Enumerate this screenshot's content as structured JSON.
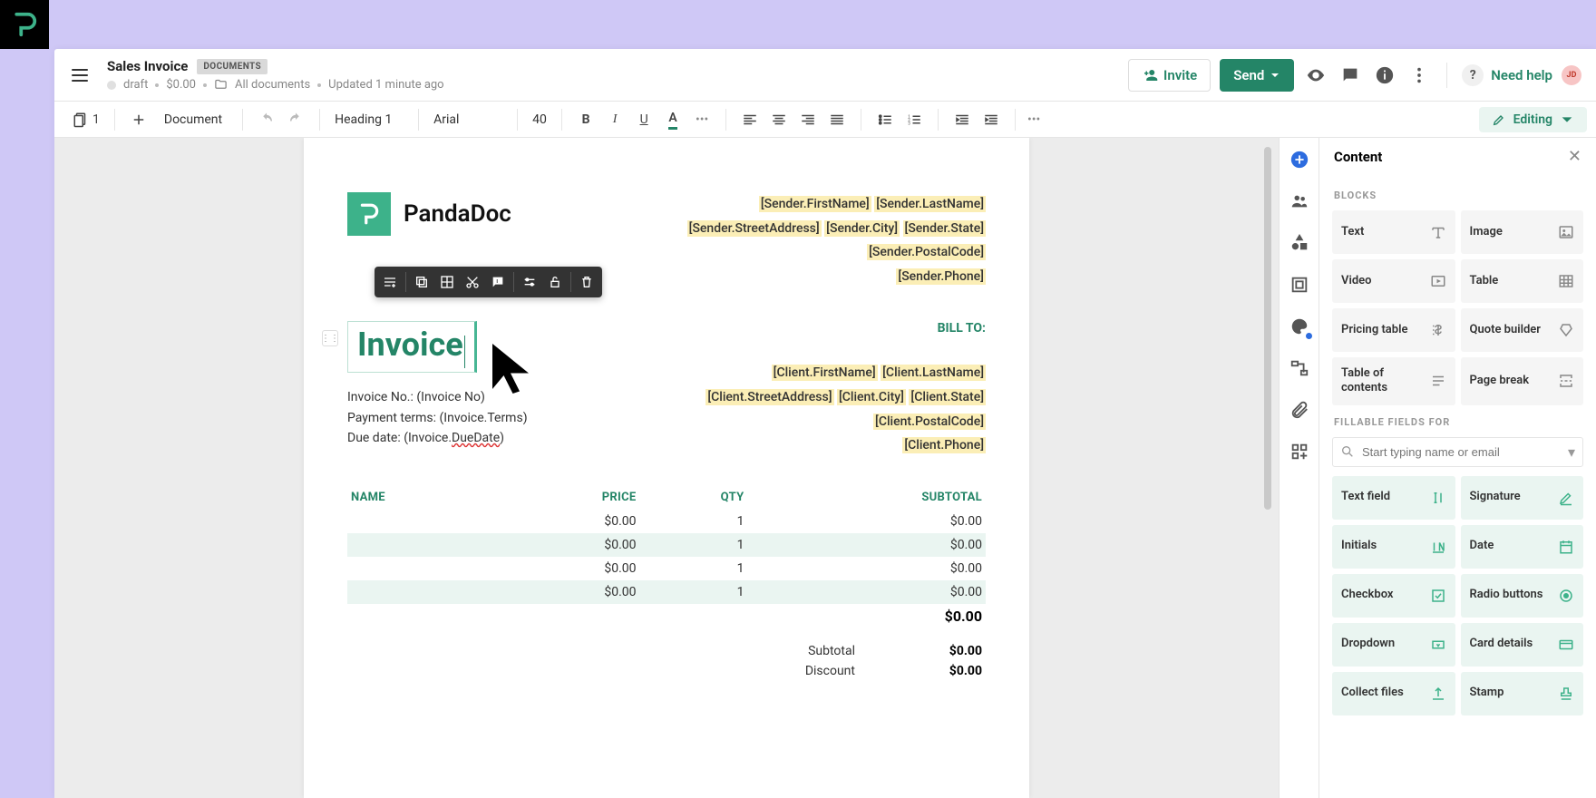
{
  "header": {
    "title": "Sales Invoice",
    "badge": "DOCUMENTS",
    "status": "draft",
    "price": "$0.00",
    "folder": "All documents",
    "updated": "Updated 1 minute ago",
    "invite": "Invite",
    "send": "Send",
    "help": "Need help",
    "avatar": "JD"
  },
  "toolbar": {
    "page_count": "1",
    "document": "Document",
    "heading": "Heading 1",
    "font": "Arial",
    "size": "40",
    "mode": "Editing"
  },
  "doc": {
    "brand": "PandaDoc",
    "sender": {
      "first": "[Sender.FirstName]",
      "last": "[Sender.LastName]",
      "street": "[Sender.StreetAddress]",
      "city": "[Sender.City]",
      "state": "[Sender.State]",
      "postal": "[Sender.PostalCode]",
      "phone": "[Sender.Phone]"
    },
    "invoice_heading": "Invoice",
    "billto_label": "BILL TO:",
    "meta": {
      "no_label": "Invoice No.: ",
      "no_val": "(Invoice No)",
      "terms_label": "Payment terms: ",
      "terms_val": "(Invoice.Terms)",
      "due_label": "Due date: ",
      "due_prefix": "(Invoice.",
      "due_squiggle": "DueDate",
      "due_suffix": ")"
    },
    "client": {
      "first": "[Client.FirstName]",
      "last": "[Client.LastName]",
      "street": "[Client.StreetAddress]",
      "city": "[Client.City]",
      "state": "[Client.State]",
      "postal": "[Client.PostalCode]",
      "phone": "[Client.Phone]"
    },
    "table": {
      "headers": {
        "name": "NAME",
        "price": "PRICE",
        "qty": "QTY",
        "subtotal": "SUBTOTAL"
      },
      "rows": [
        {
          "name": "",
          "price": "$0.00",
          "qty": "1",
          "subtotal": "$0.00"
        },
        {
          "name": "",
          "price": "$0.00",
          "qty": "1",
          "subtotal": "$0.00"
        },
        {
          "name": "",
          "price": "$0.00",
          "qty": "1",
          "subtotal": "$0.00"
        },
        {
          "name": "",
          "price": "$0.00",
          "qty": "1",
          "subtotal": "$0.00"
        }
      ],
      "grand": "$0.00",
      "subtotal_label": "Subtotal",
      "subtotal_val": "$0.00",
      "discount_label": "Discount",
      "discount_val": "$0.00"
    }
  },
  "panel": {
    "title": "Content",
    "blocks_label": "BLOCKS",
    "blocks": [
      {
        "label": "Text",
        "icon": "text"
      },
      {
        "label": "Image",
        "icon": "image"
      },
      {
        "label": "Video",
        "icon": "video"
      },
      {
        "label": "Table",
        "icon": "table"
      },
      {
        "label": "Pricing table",
        "icon": "pricing"
      },
      {
        "label": "Quote builder",
        "icon": "quote"
      },
      {
        "label": "Table of contents",
        "icon": "toc"
      },
      {
        "label": "Page break",
        "icon": "pagebreak"
      }
    ],
    "fields_label": "FILLABLE FIELDS FOR",
    "search_placeholder": "Start typing name or email",
    "fields": [
      {
        "label": "Text field",
        "icon": "textfield"
      },
      {
        "label": "Signature",
        "icon": "signature"
      },
      {
        "label": "Initials",
        "icon": "initials"
      },
      {
        "label": "Date",
        "icon": "date"
      },
      {
        "label": "Checkbox",
        "icon": "checkbox"
      },
      {
        "label": "Radio buttons",
        "icon": "radio"
      },
      {
        "label": "Dropdown",
        "icon": "dropdown"
      },
      {
        "label": "Card details",
        "icon": "card"
      },
      {
        "label": "Collect files",
        "icon": "upload"
      },
      {
        "label": "Stamp",
        "icon": "stamp"
      }
    ]
  }
}
